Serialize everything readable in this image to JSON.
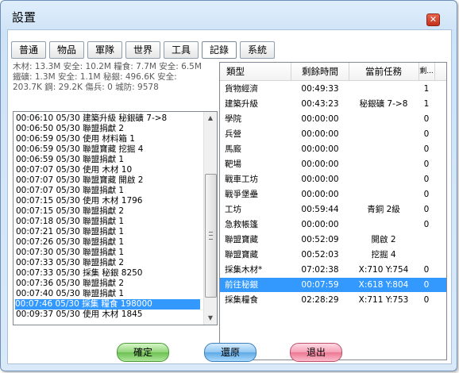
{
  "window": {
    "title": "設置",
    "close_label": "✕"
  },
  "tabs": [
    {
      "label": "普通"
    },
    {
      "label": "物品"
    },
    {
      "label": "軍隊"
    },
    {
      "label": "世界"
    },
    {
      "label": "工具"
    },
    {
      "label": "記錄",
      "active": true
    },
    {
      "label": "系統"
    }
  ],
  "stats": [
    "木材: 13.3M 安全: 10.2M  糧食: 7.7M 安全: 6.5M",
    "鐵礦: 1.3M 安全: 1.1M  秘銀: 496.6K 安全:",
    "203.7K  鋼: 29.2K  傷兵: 0   城防: 9578"
  ],
  "log": [
    "00:06:10 05/30  建築升級  秘銀礦  7->8",
    "00:06:50 05/30  聯盟捐獻  2",
    "00:06:59 05/30  使用  材料箱  1",
    "00:06:59 05/30  聯盟寶藏  挖掘  4",
    "00:06:59 05/30  聯盟捐獻  1",
    "00:07:07 05/30  使用  木材  10",
    "00:07:07 05/30  聯盟寶藏  開啟  2",
    "00:07:07 05/30  聯盟捐獻  1",
    "00:07:15 05/30  使用  木材  1796",
    "00:07:15 05/30  聯盟捐獻  2",
    "00:07:18 05/30  聯盟捐獻  1",
    "00:07:21 05/30  聯盟捐獻  1",
    "00:07:26 05/30  聯盟捐獻  1",
    "00:07:30 05/30  聯盟捐獻  1",
    "00:07:33 05/30  聯盟捐獻  2",
    "00:07:33 05/30  採集  秘銀  8250",
    "00:07:36 05/30  聯盟捐獻  2",
    "00:07:40 05/30  聯盟捐獻  1",
    "00:07:46 05/30  採集  糧食  198000",
    "00:09:37 05/30  使用  木材  1845"
  ],
  "log_selected_index": 18,
  "table": {
    "headers": [
      "類型",
      "剩餘時間",
      "當前任務",
      "剩..."
    ],
    "rows": [
      [
        "貨物經濟",
        "00:49:33",
        "",
        "1"
      ],
      [
        "建築升級",
        "00:43:23",
        "秘銀礦 7->8",
        "1"
      ],
      [
        "學院",
        "00:00:00",
        "",
        "0"
      ],
      [
        "兵營",
        "00:00:00",
        "",
        "0"
      ],
      [
        "馬廄",
        "00:00:00",
        "",
        "0"
      ],
      [
        "靶場",
        "00:00:00",
        "",
        "0"
      ],
      [
        "戰車工坊",
        "00:00:00",
        "",
        "0"
      ],
      [
        "戰爭堡壘",
        "00:00:00",
        "",
        "0"
      ],
      [
        "工坊",
        "00:59:44",
        "青銅 2級",
        "0"
      ],
      [
        "急救帳篷",
        "00:00:00",
        "",
        "0"
      ],
      [
        "聯盟寶藏",
        "00:52:09",
        "開啟 2",
        ""
      ],
      [
        "聯盟寶藏",
        "00:52:03",
        "挖掘 4",
        ""
      ],
      [
        "採集木材*",
        "07:02:38",
        "X:710 Y:754",
        "0"
      ],
      [
        "前往秘銀",
        "00:07:59",
        "X:618 Y:804",
        "0"
      ],
      [
        "採集糧食",
        "02:28:29",
        "X:711 Y:753",
        "0"
      ]
    ],
    "selected_index": 13
  },
  "buttons": {
    "ok": "確定",
    "reset": "還原",
    "exit": "退出"
  }
}
